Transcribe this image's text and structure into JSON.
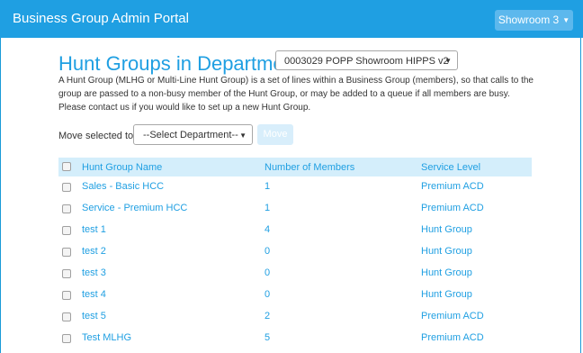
{
  "navbar": {
    "brand": "Business Group Admin Portal",
    "showroom_label": "Showroom 3"
  },
  "page": {
    "title": "Hunt Groups in Department:",
    "department_selected": "0003029 POPP Showroom HIPPS v2",
    "description": "A Hunt Group (MLHG or Multi-Line Hunt Group) is a set of lines within a Business Group (members), so that calls to the group are passed to a non-busy member of the Hunt Group, or may be added to a queue if all members are busy. Please contact us if you would like to set up a new Hunt Group."
  },
  "move": {
    "label": "Move selected to:",
    "select_value": "--Select Department--",
    "button_label": "Move"
  },
  "table": {
    "headers": [
      "Hunt Group Name",
      "Number of Members",
      "Service Level"
    ],
    "rows": [
      {
        "name": "Sales - Basic HCC",
        "members": "1",
        "level": "Premium ACD"
      },
      {
        "name": "Service - Premium HCC",
        "members": "1",
        "level": "Premium ACD"
      },
      {
        "name": "test 1",
        "members": "4",
        "level": "Hunt Group"
      },
      {
        "name": "test 2",
        "members": "0",
        "level": "Hunt Group"
      },
      {
        "name": "test 3",
        "members": "0",
        "level": "Hunt Group"
      },
      {
        "name": "test 4",
        "members": "0",
        "level": "Hunt Group"
      },
      {
        "name": "test 5",
        "members": "2",
        "level": "Premium ACD"
      },
      {
        "name": "Test MLHG",
        "members": "5",
        "level": "Premium ACD"
      }
    ]
  },
  "colors": {
    "brand": "#1f9fe2",
    "header_row": "#d4eefb",
    "showroom_button": "#5cb8ed"
  },
  "icons": {
    "dropdown": "caret-down-icon",
    "checkbox": "checkbox-icon"
  }
}
